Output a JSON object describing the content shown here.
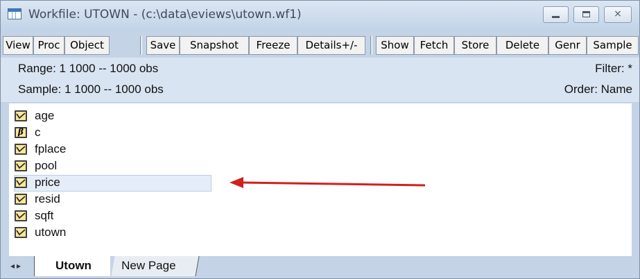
{
  "window": {
    "title": "Workfile: UTOWN - (c:\\data\\eviews\\utown.wf1)",
    "close_glyph": "⨯"
  },
  "toolbar": {
    "buttons": [
      "View",
      "Proc",
      "Object",
      "Save",
      "Snapshot",
      "Freeze",
      "Details+/-",
      "Show",
      "Fetch",
      "Store",
      "Delete",
      "Genr",
      "Sample"
    ]
  },
  "info": {
    "range": "Range:  1 1000   --   1000 obs",
    "sample": "Sample: 1 1000   --   1000 obs",
    "filter": "Filter: *",
    "order": "Order: Name"
  },
  "objects": [
    {
      "name": "age",
      "icon": "series-icon"
    },
    {
      "name": "c",
      "icon": "coefficient-icon",
      "glyph": "β"
    },
    {
      "name": "fplace",
      "icon": "series-icon"
    },
    {
      "name": "pool",
      "icon": "series-icon"
    },
    {
      "name": "price",
      "icon": "series-icon",
      "selected": true
    },
    {
      "name": "resid",
      "icon": "series-icon"
    },
    {
      "name": "sqft",
      "icon": "series-icon"
    },
    {
      "name": "utown",
      "icon": "series-icon"
    }
  ],
  "tabs": {
    "nav_glyphs": "◂▸",
    "active": "Utown",
    "new_page": "New Page"
  },
  "colors": {
    "arrow": "#d02020",
    "series_icon_fill": "#fbe79a",
    "selection": "#e5eef8"
  }
}
